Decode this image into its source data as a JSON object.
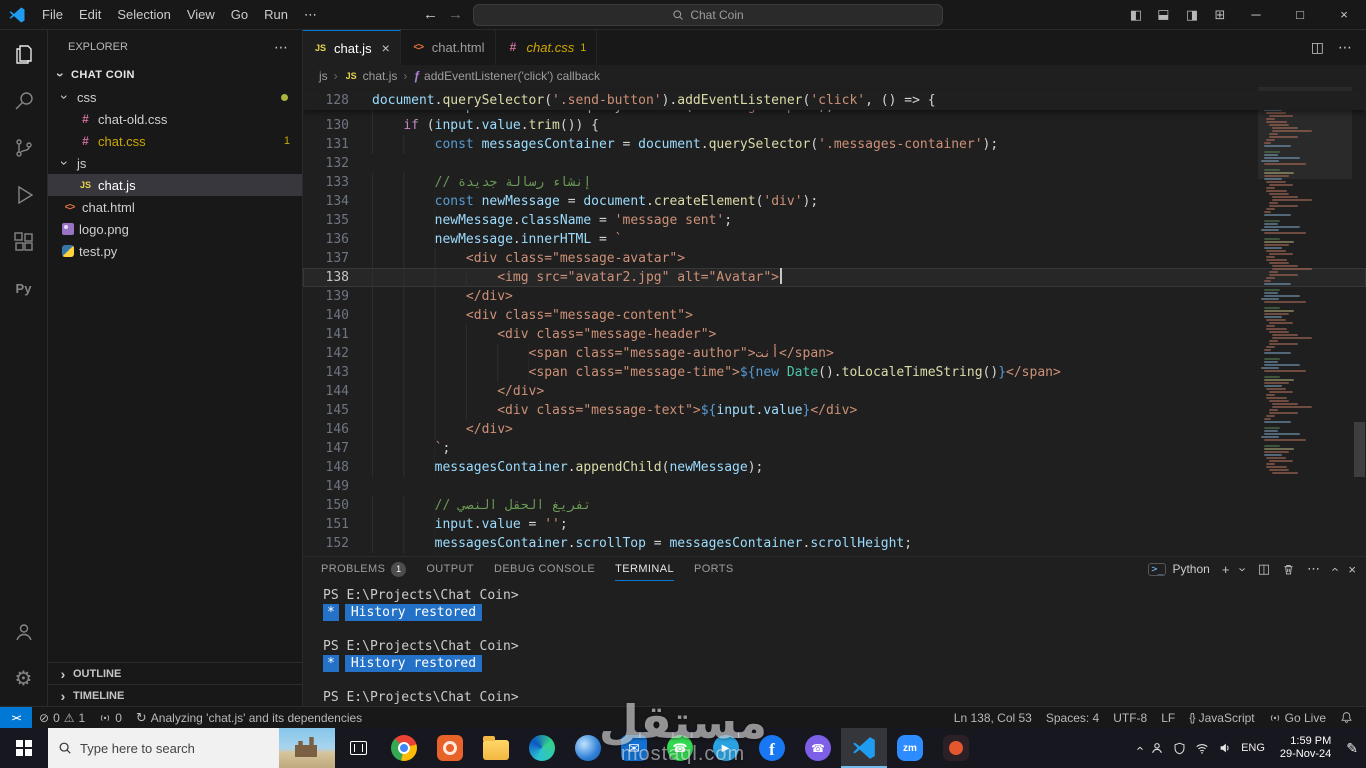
{
  "colors": {
    "accent": "#0078d4",
    "warning": "#cca700",
    "terminal_highlight": "#2472c8",
    "modified_dot": "#a9b53f"
  },
  "title_bar": {
    "menus": [
      "File",
      "Edit",
      "Selection",
      "View",
      "Go",
      "Run",
      "⋯"
    ],
    "search": "Chat Coin"
  },
  "activity_bar": {
    "top": [
      "explorer",
      "search",
      "source-control",
      "run-debug",
      "extensions",
      "python"
    ],
    "bottom": [
      "account",
      "settings"
    ]
  },
  "explorer": {
    "title": "EXPLORER",
    "project": "CHAT COIN",
    "sections": [
      "OUTLINE",
      "TIMELINE"
    ],
    "tree": [
      {
        "label": "css",
        "type": "folder",
        "expanded": true,
        "dot": true
      },
      {
        "label": "chat-old.css",
        "icon": "css",
        "level": 1
      },
      {
        "label": "chat.css",
        "icon": "css",
        "level": 1,
        "badge": "1",
        "warn": true
      },
      {
        "label": "js",
        "type": "folder",
        "expanded": true
      },
      {
        "label": "chat.js",
        "icon": "js",
        "level": 1,
        "selected": true
      },
      {
        "label": "chat.html",
        "icon": "html",
        "level": 0
      },
      {
        "label": "logo.png",
        "icon": "image",
        "level": 0
      },
      {
        "label": "test.py",
        "icon": "python",
        "level": 0
      }
    ]
  },
  "tabs": [
    {
      "label": "chat.js",
      "icon": "js",
      "active": true
    },
    {
      "label": "chat.html",
      "icon": "html"
    },
    {
      "label": "chat.css",
      "icon": "css",
      "italic": true,
      "badge": "1"
    }
  ],
  "breadcrumb": [
    {
      "label": "js"
    },
    {
      "label": "chat.js",
      "icon": "js"
    },
    {
      "label": "addEventListener('click') callback",
      "icon": "symbol"
    }
  ],
  "editor": {
    "sticky": {
      "n": 128,
      "ind": 0,
      "t": [
        [
          "v",
          "document"
        ],
        [
          "p",
          "."
        ],
        [
          "f",
          "querySelector"
        ],
        [
          "p",
          "("
        ],
        [
          "s",
          "'.send-button'"
        ],
        [
          "p",
          ")."
        ],
        [
          "f",
          "addEventListener"
        ],
        [
          "p",
          "("
        ],
        [
          "s",
          "'click'"
        ],
        [
          "p",
          ", () => {"
        ]
      ]
    },
    "hidden_line": {
      "n": 129,
      "ind": 4,
      "t": [
        [
          "k",
          "const"
        ],
        [
          "p",
          " "
        ],
        [
          "v",
          "input"
        ],
        [
          "p",
          " = "
        ],
        [
          "v",
          "document"
        ],
        [
          "p",
          "."
        ],
        [
          "f",
          "querySelector"
        ],
        [
          "p",
          "("
        ],
        [
          "s",
          "'.message-input'"
        ],
        [
          "p",
          ");"
        ]
      ]
    },
    "lines": [
      {
        "n": 130,
        "ind": 4,
        "t": [
          [
            "c",
            "if"
          ],
          [
            "p",
            " ("
          ],
          [
            "v",
            "input"
          ],
          [
            "p",
            "."
          ],
          [
            "v",
            "value"
          ],
          [
            "p",
            "."
          ],
          [
            "f",
            "trim"
          ],
          [
            "p",
            "()) {"
          ]
        ]
      },
      {
        "n": 131,
        "ind": 8,
        "t": [
          [
            "k",
            "const"
          ],
          [
            "p",
            " "
          ],
          [
            "v",
            "messagesContainer"
          ],
          [
            "p",
            " = "
          ],
          [
            "v",
            "document"
          ],
          [
            "p",
            "."
          ],
          [
            "f",
            "querySelector"
          ],
          [
            "p",
            "("
          ],
          [
            "s",
            "'.messages-container'"
          ],
          [
            "p",
            ");"
          ]
        ]
      },
      {
        "n": 132,
        "ind": 0,
        "t": []
      },
      {
        "n": 133,
        "ind": 8,
        "t": [
          [
            "m",
            "// إنشاء رسالة جديدة"
          ]
        ]
      },
      {
        "n": 134,
        "ind": 8,
        "t": [
          [
            "k",
            "const"
          ],
          [
            "p",
            " "
          ],
          [
            "v",
            "newMessage"
          ],
          [
            "p",
            " = "
          ],
          [
            "v",
            "document"
          ],
          [
            "p",
            "."
          ],
          [
            "f",
            "createElement"
          ],
          [
            "p",
            "("
          ],
          [
            "s",
            "'div'"
          ],
          [
            "p",
            ");"
          ]
        ]
      },
      {
        "n": 135,
        "ind": 8,
        "t": [
          [
            "v",
            "newMessage"
          ],
          [
            "p",
            "."
          ],
          [
            "v",
            "className"
          ],
          [
            "p",
            " = "
          ],
          [
            "s",
            "'message sent'"
          ],
          [
            "p",
            ";"
          ]
        ]
      },
      {
        "n": 136,
        "ind": 8,
        "t": [
          [
            "v",
            "newMessage"
          ],
          [
            "p",
            "."
          ],
          [
            "v",
            "innerHTML"
          ],
          [
            "p",
            " = "
          ],
          [
            "s",
            "`"
          ]
        ]
      },
      {
        "n": 137,
        "ind": 12,
        "t": [
          [
            "s",
            "<div class=\"message-avatar\">"
          ]
        ]
      },
      {
        "n": 138,
        "ind": 16,
        "cur": true,
        "caret": true,
        "t": [
          [
            "s",
            "<img src=\"avatar2.jpg\" alt=\"Avatar\">"
          ]
        ]
      },
      {
        "n": 139,
        "ind": 12,
        "t": [
          [
            "s",
            "</div>"
          ]
        ]
      },
      {
        "n": 140,
        "ind": 12,
        "t": [
          [
            "s",
            "<div class=\"message-content\">"
          ]
        ]
      },
      {
        "n": 141,
        "ind": 16,
        "t": [
          [
            "s",
            "<div class=\"message-header\">"
          ]
        ]
      },
      {
        "n": 142,
        "ind": 20,
        "t": [
          [
            "s",
            "<span class=\"message-author\">أنت</span>"
          ]
        ]
      },
      {
        "n": 143,
        "ind": 20,
        "t": [
          [
            "s",
            "<span class=\"message-time\">"
          ],
          [
            "k",
            "${"
          ],
          [
            "k",
            "new"
          ],
          [
            "p",
            " "
          ],
          [
            "t",
            "Date"
          ],
          [
            "p",
            "()."
          ],
          [
            "f",
            "toLocaleTimeString"
          ],
          [
            "p",
            "()"
          ],
          [
            "k",
            "}"
          ],
          [
            "s",
            "</span>"
          ]
        ]
      },
      {
        "n": 144,
        "ind": 16,
        "t": [
          [
            "s",
            "</div>"
          ]
        ]
      },
      {
        "n": 145,
        "ind": 16,
        "t": [
          [
            "s",
            "<div class=\"message-text\">"
          ],
          [
            "k",
            "${"
          ],
          [
            "v",
            "input"
          ],
          [
            "p",
            "."
          ],
          [
            "v",
            "value"
          ],
          [
            "k",
            "}"
          ],
          [
            "s",
            "</div>"
          ]
        ]
      },
      {
        "n": 146,
        "ind": 12,
        "t": [
          [
            "s",
            "</div>"
          ]
        ]
      },
      {
        "n": 147,
        "ind": 8,
        "t": [
          [
            "s",
            "`"
          ],
          [
            "p",
            ";"
          ]
        ]
      },
      {
        "n": 148,
        "ind": 8,
        "t": [
          [
            "v",
            "messagesContainer"
          ],
          [
            "p",
            "."
          ],
          [
            "f",
            "appendChild"
          ],
          [
            "p",
            "("
          ],
          [
            "v",
            "newMessage"
          ],
          [
            "p",
            ");"
          ]
        ]
      },
      {
        "n": 149,
        "ind": 0,
        "t": []
      },
      {
        "n": 150,
        "ind": 8,
        "t": [
          [
            "m",
            "// تفريغ الحقل النصي"
          ]
        ]
      },
      {
        "n": 151,
        "ind": 8,
        "t": [
          [
            "v",
            "input"
          ],
          [
            "p",
            "."
          ],
          [
            "v",
            "value"
          ],
          [
            "p",
            " = "
          ],
          [
            "s",
            "''"
          ],
          [
            "p",
            ";"
          ]
        ]
      },
      {
        "n": 152,
        "ind": 8,
        "t": [
          [
            "v",
            "messagesContainer"
          ],
          [
            "p",
            "."
          ],
          [
            "v",
            "scrollTop"
          ],
          [
            "p",
            " = "
          ],
          [
            "v",
            "messagesContainer"
          ],
          [
            "p",
            "."
          ],
          [
            "v",
            "scrollHeight"
          ],
          [
            "p",
            ";"
          ]
        ]
      }
    ]
  },
  "panel": {
    "tabs": [
      {
        "label": "PROBLEMS",
        "badge": "1"
      },
      {
        "label": "OUTPUT"
      },
      {
        "label": "DEBUG CONSOLE"
      },
      {
        "label": "TERMINAL",
        "active": true
      },
      {
        "label": "PORTS"
      }
    ],
    "shell_label": "Python",
    "terminal_lines": [
      {
        "kind": "prompt",
        "text": "PS E:\\Projects\\Chat Coin>"
      },
      {
        "kind": "history",
        "star": "*",
        "text": "History restored"
      },
      {
        "kind": "blank"
      },
      {
        "kind": "prompt",
        "text": "PS E:\\Projects\\Chat Coin>"
      },
      {
        "kind": "history",
        "star": "*",
        "text": "History restored"
      },
      {
        "kind": "blank"
      },
      {
        "kind": "prompt",
        "text": "PS E:\\Projects\\Chat Coin>"
      }
    ]
  },
  "status_bar": {
    "errors": "0",
    "warnings": "1",
    "ports": "0",
    "analyzing": "Analyzing 'chat.js' and its dependencies",
    "line_col": "Ln 138, Col 53",
    "spaces": "Spaces: 4",
    "encoding": "UTF-8",
    "eol": "LF",
    "language": "JavaScript",
    "language_icon": "{}",
    "go_live": "Go Live"
  },
  "taskbar": {
    "search_placeholder": "Type here to search",
    "language_indicator": "ENG",
    "time": "1:59 PM",
    "date": "29-Nov-24",
    "apps": [
      {
        "name": "chrome"
      },
      {
        "name": "app-orange"
      },
      {
        "name": "file-explorer"
      },
      {
        "name": "edge"
      },
      {
        "name": "browser-blue"
      },
      {
        "name": "mail"
      },
      {
        "name": "whatsapp"
      },
      {
        "name": "telegram"
      },
      {
        "name": "facebook"
      },
      {
        "name": "viber"
      },
      {
        "name": "vscode",
        "active": true
      },
      {
        "name": "zoom"
      },
      {
        "name": "app-dark"
      }
    ]
  },
  "watermark": {
    "title": "مستقل",
    "domain": "mostaql.com"
  }
}
